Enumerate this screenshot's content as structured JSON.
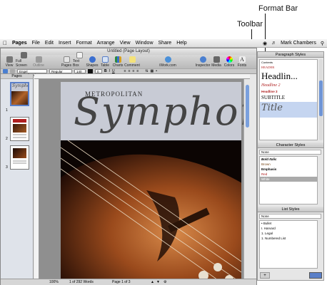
{
  "callouts": {
    "format_bar": "Format Bar",
    "toolbar": "Toolbar"
  },
  "menubar": {
    "app": "Pages",
    "items": [
      "File",
      "Edit",
      "Insert",
      "Format",
      "Arrange",
      "View",
      "Window",
      "Share",
      "Help"
    ],
    "user": "Mark Chambers"
  },
  "window": {
    "title": "Untitled (Page Layout)"
  },
  "toolbar": {
    "buttons": [
      "View",
      "Full Screen",
      "Outline",
      "Pages",
      "Text Box",
      "Shapes",
      "Table",
      "Charts",
      "Comment",
      "iWork.com",
      "Inspector",
      "Media",
      "Colors",
      "Fonts"
    ]
  },
  "formatbar": {
    "font": "Engel Roundhand",
    "style": "Regular",
    "size": "140",
    "box": "0"
  },
  "sidebar": {
    "header": "Pages",
    "page_numbers": [
      "1",
      "2",
      "3"
    ]
  },
  "document": {
    "metropolitan": "METROPOLITAN",
    "title": "Symphony"
  },
  "status": {
    "zoom": "100%",
    "words": "1 of 292 Words",
    "page": "Page 1 of 3"
  },
  "paragraph_styles": {
    "header": "Paragraph Styles",
    "items": [
      "Contents",
      "HEADER",
      "Headlin...",
      "Headline 2",
      "Headline 3",
      "SUBTITLE",
      "Title"
    ]
  },
  "character_styles": {
    "header": "Character Styles",
    "selected": "None",
    "items": [
      "Bold Italic",
      "Brown",
      "Emphasis",
      "Red",
      "White"
    ]
  },
  "list_styles": {
    "header": "List Styles",
    "selected": "None",
    "items": [
      "• Bullet",
      "I. Harvard",
      "1. Legal",
      "1. Numbered List"
    ]
  },
  "colors": {
    "accent": "#5a7fc8",
    "title_band": "#c8cbd5",
    "red": "#b02020"
  }
}
